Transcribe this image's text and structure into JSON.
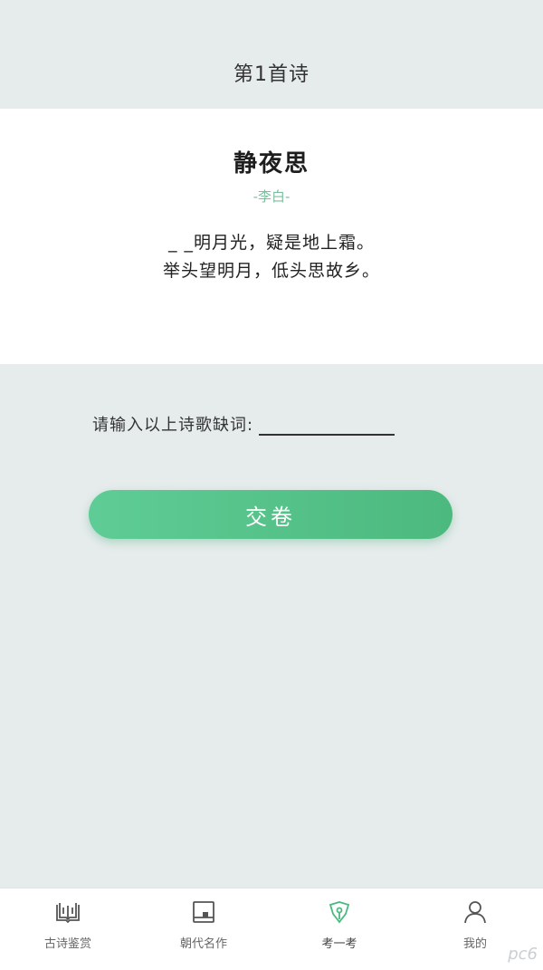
{
  "header": {
    "title": "第1首诗"
  },
  "poem": {
    "title": "静夜思",
    "author": "-李白-",
    "lines": [
      "_ _明月光，疑是地上霜。",
      "举头望明月，低头思故乡。"
    ]
  },
  "quiz": {
    "prompt": "请输入以上诗歌缺词:",
    "answer_value": "",
    "submit_label": "交卷"
  },
  "tabbar": {
    "items": [
      {
        "label": "古诗鉴赏",
        "icon": "open-book-icon"
      },
      {
        "label": "朝代名作",
        "icon": "notebook-icon"
      },
      {
        "label": "考一考",
        "icon": "pen-nib-icon",
        "active": true
      },
      {
        "label": "我的",
        "icon": "user-icon"
      }
    ],
    "active_color": "#4cb97e"
  },
  "watermark": "pc6"
}
